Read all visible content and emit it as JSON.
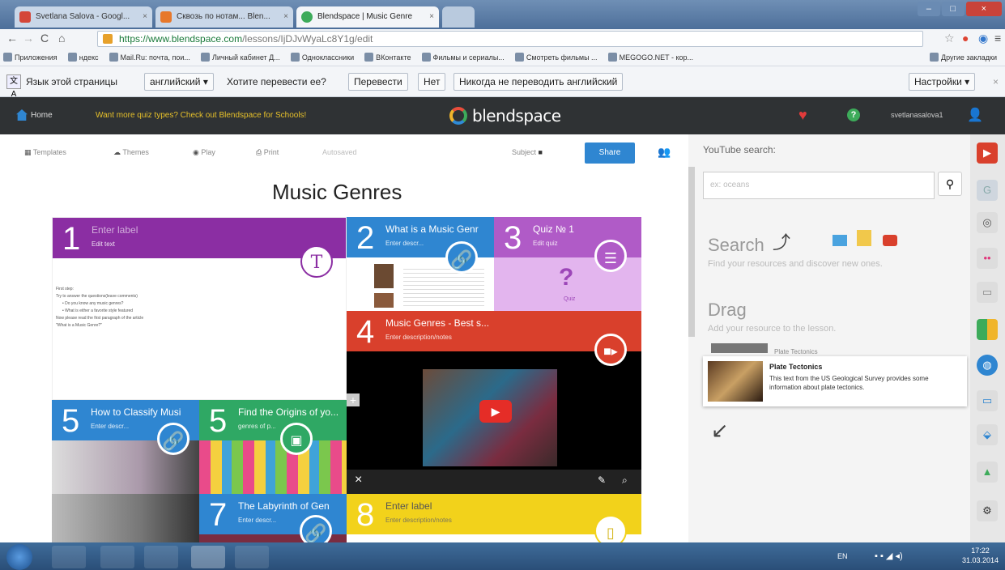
{
  "browser": {
    "tabs": [
      {
        "label": "Svetlana Salova - Googl...",
        "color": "#d44638"
      },
      {
        "label": "Сквозь по нотам... Blen...",
        "color": "#e7782b"
      },
      {
        "label": "Blendspace | Music Genre",
        "color": "#3dab5a"
      }
    ],
    "url_host": "https://www.blendspace.com",
    "url_path": "/lessons/IjDJvWyaLc8Y1g/edit",
    "bookmarks": [
      "Приложения",
      "ндекс",
      "Mail.Ru: почта, пои...",
      "Личный кабинет Д...",
      "Одноклассники",
      "ВКонтакте",
      "Фильмы и сериалы...",
      "Смотреть фильмы ...",
      "MEGOGO.NET - кор..."
    ],
    "other_bookmarks": "Другие закладки"
  },
  "translate": {
    "prefix": "Язык этой страницы",
    "language": "английский",
    "question": "Хотите перевести ее?",
    "translate_btn": "Перевести",
    "no_btn": "Нет",
    "never_btn": "Никогда не переводить английский",
    "settings_btn": "Настройки"
  },
  "header": {
    "home": "Home",
    "promo": "Want more quiz types? Check out Blendspace for Schools!",
    "logo": "blendspace",
    "username": "svetlanasalova1"
  },
  "toolbar": {
    "templates": "Templates",
    "themes": "Themes",
    "play": "Play",
    "print": "Print",
    "autosaved": "Autosaved",
    "subject": "Subject",
    "share": "Share"
  },
  "lesson": {
    "title": "Music Genres",
    "tiles": [
      {
        "num": "1",
        "label": "Enter label",
        "sub": "Edit text",
        "color": "#8b2ea3"
      },
      {
        "num": "2",
        "label": "What is a Music Genr",
        "sub": "Enter descr...",
        "color": "#2f86d1"
      },
      {
        "num": "3",
        "label": "Quiz № 1",
        "sub": "Edit quiz",
        "color": "#b05bc7"
      },
      {
        "num": "4",
        "label": "Music Genres - Best s...",
        "sub": "Enter description/notes",
        "color": "#d9402c"
      },
      {
        "num": "5",
        "label": "How to Classify Musi",
        "sub": "Enter descr...",
        "color": "#2f86d1"
      },
      {
        "num": "5",
        "label": "Find the Origins of yo...",
        "sub": "genres of p...",
        "color": "#2fa864"
      },
      {
        "num": "7",
        "label": "The Labyrinth of Gen",
        "sub": "Enter descr...",
        "color": "#2f86d1"
      },
      {
        "num": "8",
        "label": "Enter label",
        "sub": "Enter description/notes",
        "color": "#f2d21b"
      }
    ],
    "text_lines": [
      "First step:",
      "Try to answer the questions(leave comments)",
      "• Do you know any music genres?",
      "• What is either a favorite style featured",
      "Now please read the first paragraph of the article",
      "\"What is a Music Genre?\""
    ],
    "quiz_label": "Quiz"
  },
  "panel": {
    "youtube_label": "YouTube search:",
    "search_placeholder": "ex: oceans",
    "search_title": "Search",
    "search_hint": "Find your resources and discover new ones.",
    "drag_title": "Drag",
    "drag_hint": "Add your resource to the lesson.",
    "ghost_title": "Plate Tectonics",
    "card_title": "Plate Tectonics",
    "card_text": "This text from the US Geological Survey provides some information about plate tectonics."
  },
  "taskbar": {
    "lang": "EN",
    "time": "17:22",
    "date": "31.03.2014"
  }
}
